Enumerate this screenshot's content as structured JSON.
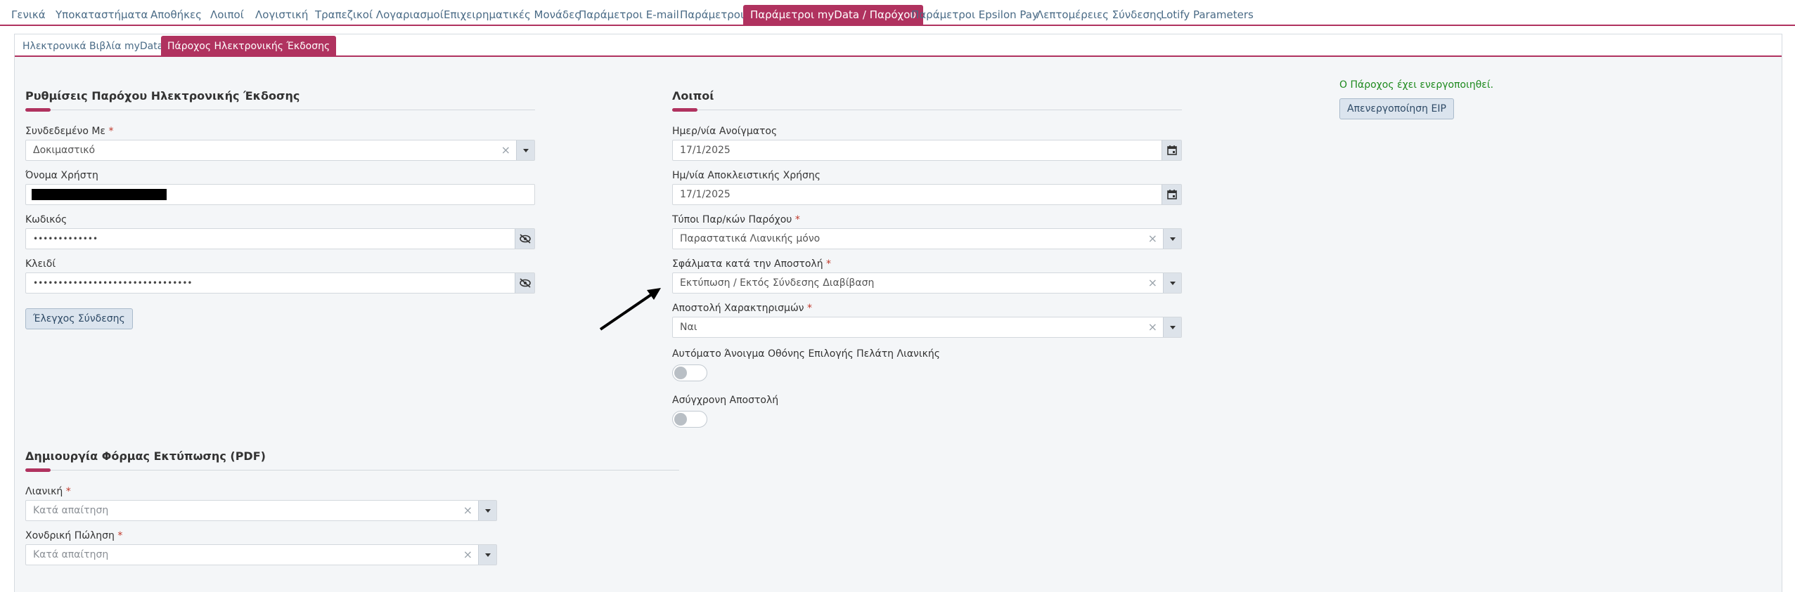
{
  "top_tabs": [
    {
      "label": "Γενικά"
    },
    {
      "label": "Υποκαταστήματα"
    },
    {
      "label": "Αποθήκες"
    },
    {
      "label": "Λοιποί"
    },
    {
      "label": "Λογιστική"
    },
    {
      "label": "Τραπεζικοί Λογαριασμοί"
    },
    {
      "label": "Επιχειρηματικές Μονάδες"
    },
    {
      "label": "Παράμετροι E-mail"
    },
    {
      "label": "Παράμετροι"
    },
    {
      "label": "Παράμετροι myData / Παρόχου",
      "active": true
    },
    {
      "label": "Παράμετροι Epsilon Pay"
    },
    {
      "label": "Λεπτομέρειες Σύνδεσης"
    },
    {
      "label": "Lotify Parameters"
    }
  ],
  "sub_tabs": [
    {
      "label": "Ηλεκτρονικά Βιβλία myData"
    },
    {
      "label": "Πάροχος Ηλεκτρονικής Έκδοσης",
      "active": true
    }
  ],
  "provider_settings": {
    "title": "Ρυθμίσεις Παρόχου Ηλεκτρονικής Έκδοσης",
    "connected_with": {
      "label": "Συνδεδεμένο Με",
      "required": "*",
      "value": "Δοκιμαστικό"
    },
    "username": {
      "label": "Όνομα Χρήστη"
    },
    "password": {
      "label": "Κωδικός",
      "value": "•••••••••••••"
    },
    "key": {
      "label": "Κλειδί",
      "value": "••••••••••••••••••••••••••••••••"
    },
    "test_connection_button": "Έλεγχος Σύνδεσης"
  },
  "pdf_form": {
    "title": "Δημιουργία Φόρμας Εκτύπωσης (PDF)",
    "retail": {
      "label": "Λιανική",
      "required": "*",
      "placeholder": "Κατά απαίτηση"
    },
    "wholesale": {
      "label": "Χονδρική Πώληση",
      "required": "*",
      "placeholder": "Κατά απαίτηση"
    }
  },
  "others": {
    "title": "Λοιποί",
    "open_date": {
      "label": "Ημερ/νία Ανοίγματος",
      "value": "17/1/2025"
    },
    "exclusive_date": {
      "label": "Ημ/νία Αποκλειστικής Χρήσης",
      "value": "17/1/2025"
    },
    "provider_doc_types": {
      "label": "Τύποι Παρ/κών Παρόχου",
      "required": "*",
      "value": "Παραστατικά Λιανικής μόνο"
    },
    "send_errors": {
      "label": "Σφάλματα κατά την Αποστολή",
      "required": "*",
      "value": "Εκτύπωση / Εκτός Σύνδεσης Διαβίβαση"
    },
    "send_characterizations": {
      "label": "Αποστολή Χαρακτηρισμών",
      "required": "*",
      "value": "Ναι"
    },
    "auto_open_retail": {
      "label": "Αυτόματο Άνοιγμα Οθόνης Επιλογής Πελάτη Λιανικής",
      "on": false
    },
    "async_send": {
      "label": "Ασύγχρονη Αποστολή",
      "on": false
    }
  },
  "status": {
    "message": "Ο Πάροχος έχει ενεργοποιηθεί.",
    "deactivate_button": "Απενεργοποίηση EIP"
  },
  "colors": {
    "accent": "#b0325f",
    "success": "#1e8a1e",
    "link": "#4a6b86"
  },
  "icons": {
    "clear": "×",
    "dropdown": "chevron-down-icon",
    "reveal": "eye-off-icon",
    "calendar": "calendar-icon"
  }
}
